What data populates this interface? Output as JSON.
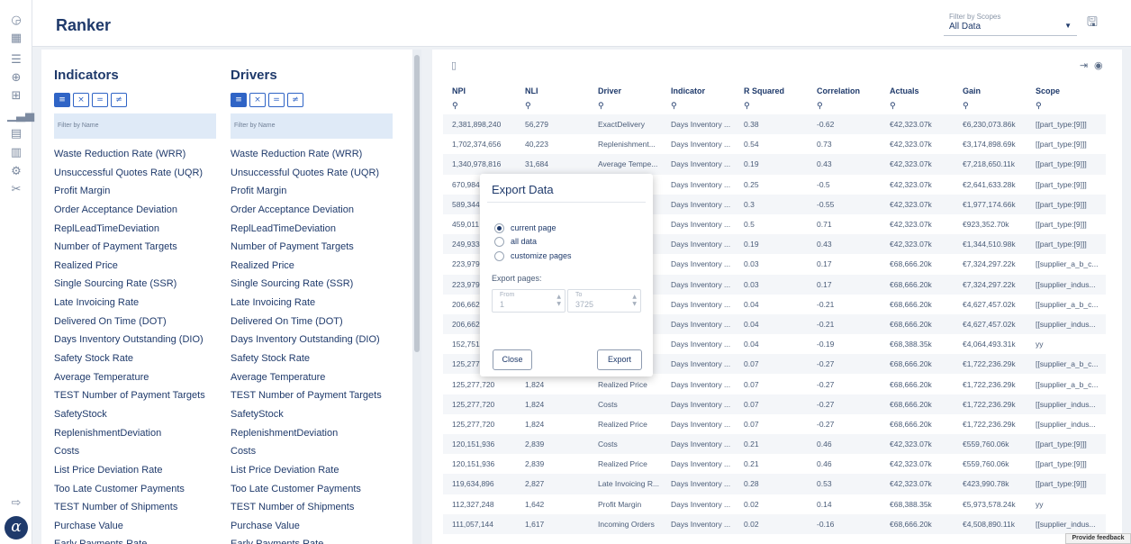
{
  "header": {
    "title": "Ranker"
  },
  "scope_filter": {
    "label": "Filter by Scopes",
    "value": "All Data"
  },
  "rail_icons": [
    "dashboard-icon",
    "grid-icon",
    "list-icon",
    "settings-icon",
    "table-icon",
    "chart-icon",
    "calendar-icon",
    "layout-icon",
    "gear-icon",
    "tools-icon",
    "logout-icon"
  ],
  "indicators": {
    "title": "Indicators",
    "filter_placeholder": "Filter by Name",
    "items": [
      "Waste Reduction Rate (WRR)",
      "Unsuccessful Quotes Rate (UQR)",
      "Profit Margin",
      "Order Acceptance Deviation",
      "ReplLeadTimeDeviation",
      "Number of Payment Targets",
      "Realized Price",
      "Single Sourcing Rate (SSR)",
      "Late Invoicing Rate",
      "Delivered On Time (DOT)",
      "Days Inventory Outstanding (DIO)",
      "Safety Stock Rate",
      "Average Temperature",
      "TEST Number of Payment Targets",
      "SafetyStock",
      "ReplenishmentDeviation",
      "Costs",
      "List Price Deviation Rate",
      "Too Late Customer Payments",
      "TEST Number of Shipments",
      "Purchase Value",
      "Early Payments Rate"
    ]
  },
  "drivers": {
    "title": "Drivers",
    "filter_placeholder": "Filter by Name",
    "items": [
      "Waste Reduction Rate (WRR)",
      "Unsuccessful Quotes Rate (UQR)",
      "Profit Margin",
      "Order Acceptance Deviation",
      "ReplLeadTimeDeviation",
      "Number of Payment Targets",
      "Realized Price",
      "Single Sourcing Rate (SSR)",
      "Late Invoicing Rate",
      "Delivered On Time (DOT)",
      "Days Inventory Outstanding (DIO)",
      "Safety Stock Rate",
      "Average Temperature",
      "TEST Number of Payment Targets",
      "SafetyStock",
      "ReplenishmentDeviation",
      "Costs",
      "List Price Deviation Rate",
      "Too Late Customer Payments",
      "TEST Number of Shipments",
      "Purchase Value",
      "Early Payments Rate"
    ]
  },
  "table": {
    "columns": [
      "NPI",
      "NLI",
      "Driver",
      "Indicator",
      "R Squared",
      "Correlation",
      "Actuals",
      "Gain",
      "Scope"
    ],
    "rows": [
      [
        "2,381,898,240",
        "56,279",
        "ExactDelivery",
        "Days Inventory ...",
        "0.38",
        "-0.62",
        "€42,323.07k",
        "€6,230,073.86k",
        "[[part_type:[9]]]"
      ],
      [
        "1,702,374,656",
        "40,223",
        "Replenishment...",
        "Days Inventory ...",
        "0.54",
        "0.73",
        "€42,323.07k",
        "€3,174,898.69k",
        "[[part_type:[9]]]"
      ],
      [
        "1,340,978,816",
        "31,684",
        "Average Tempe...",
        "Days Inventory ...",
        "0.19",
        "0.43",
        "€42,323.07k",
        "€7,218,650.11k",
        "[[part_type:[9]]]"
      ],
      [
        "670,984",
        "",
        "",
        "Days Inventory ...",
        "0.25",
        "-0.5",
        "€42,323.07k",
        "€2,641,633.28k",
        "[[part_type:[9]]]"
      ],
      [
        "589,344",
        "",
        "",
        "Days Inventory ...",
        "0.3",
        "-0.55",
        "€42,323.07k",
        "€1,977,174.66k",
        "[[part_type:[9]]]"
      ],
      [
        "459,011",
        "",
        "",
        "Days Inventory ...",
        "0.5",
        "0.71",
        "€42,323.07k",
        "€923,352.70k",
        "[[part_type:[9]]]"
      ],
      [
        "249,933",
        "",
        "",
        "Days Inventory ...",
        "0.19",
        "0.43",
        "€42,323.07k",
        "€1,344,510.98k",
        "[[part_type:[9]]]"
      ],
      [
        "223,979",
        "",
        "",
        "Days Inventory ...",
        "0.03",
        "0.17",
        "€68,666.20k",
        "€7,324,297.22k",
        "[[supplier_a_b_c..."
      ],
      [
        "223,979",
        "",
        "",
        "Days Inventory ...",
        "0.03",
        "0.17",
        "€68,666.20k",
        "€7,324,297.22k",
        "[[supplier_indus..."
      ],
      [
        "206,662",
        "",
        "",
        "Days Inventory ...",
        "0.04",
        "-0.21",
        "€68,666.20k",
        "€4,627,457.02k",
        "[[supplier_a_b_c..."
      ],
      [
        "206,662",
        "",
        "",
        "Days Inventory ...",
        "0.04",
        "-0.21",
        "€68,666.20k",
        "€4,627,457.02k",
        "[[supplier_indus..."
      ],
      [
        "152,751",
        "",
        "",
        "Days Inventory ...",
        "0.04",
        "-0.19",
        "€68,388.35k",
        "€4,064,493.31k",
        "yy"
      ],
      [
        "125,277",
        "",
        "",
        "Days Inventory ...",
        "0.07",
        "-0.27",
        "€68,666.20k",
        "€1,722,236.29k",
        "[[supplier_a_b_c..."
      ],
      [
        "125,277,720",
        "1,824",
        "Realized Price",
        "Days Inventory ...",
        "0.07",
        "-0.27",
        "€68,666.20k",
        "€1,722,236.29k",
        "[[supplier_a_b_c..."
      ],
      [
        "125,277,720",
        "1,824",
        "Costs",
        "Days Inventory ...",
        "0.07",
        "-0.27",
        "€68,666.20k",
        "€1,722,236.29k",
        "[[supplier_indus..."
      ],
      [
        "125,277,720",
        "1,824",
        "Realized Price",
        "Days Inventory ...",
        "0.07",
        "-0.27",
        "€68,666.20k",
        "€1,722,236.29k",
        "[[supplier_indus..."
      ],
      [
        "120,151,936",
        "2,839",
        "Costs",
        "Days Inventory ...",
        "0.21",
        "0.46",
        "€42,323.07k",
        "€559,760.06k",
        "[[part_type:[9]]]"
      ],
      [
        "120,151,936",
        "2,839",
        "Realized Price",
        "Days Inventory ...",
        "0.21",
        "0.46",
        "€42,323.07k",
        "€559,760.06k",
        "[[part_type:[9]]]"
      ],
      [
        "119,634,896",
        "2,827",
        "Late Invoicing R...",
        "Days Inventory ...",
        "0.28",
        "0.53",
        "€42,323.07k",
        "€423,990.78k",
        "[[part_type:[9]]]"
      ],
      [
        "112,327,248",
        "1,642",
        "Profit Margin",
        "Days Inventory ...",
        "0.02",
        "0.14",
        "€68,388.35k",
        "€5,973,578.24k",
        "yy"
      ],
      [
        "111,057,144",
        "1,617",
        "Incoming Orders",
        "Days Inventory ...",
        "0.02",
        "-0.16",
        "€68,666.20k",
        "€4,508,890.11k",
        "[[supplier_indus..."
      ]
    ]
  },
  "export_modal": {
    "title": "Export Data",
    "options": [
      "current page",
      "all data",
      "customize pages"
    ],
    "selected_option": "current page",
    "export_pages_label": "Export pages:",
    "from_label": "From",
    "from_value": "1",
    "to_label": "To",
    "to_value": "3725",
    "close_label": "Close",
    "export_label": "Export"
  },
  "feedback_label": "Provide feedback"
}
